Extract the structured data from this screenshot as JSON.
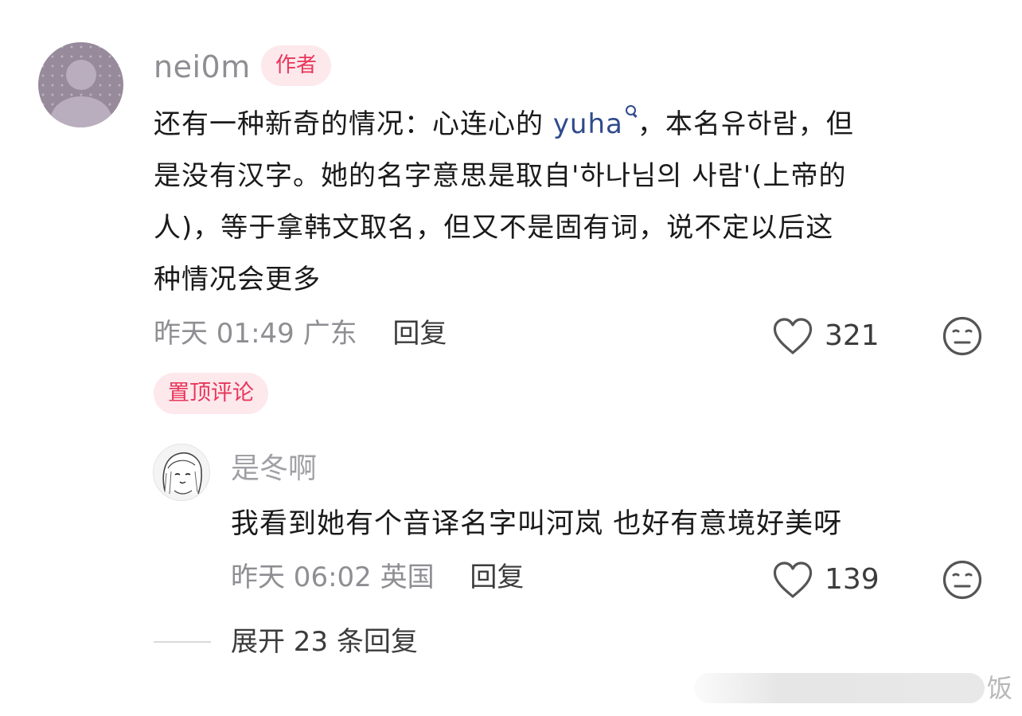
{
  "main_comment": {
    "username": "nei0m",
    "author_badge": "作者",
    "body_lines": {
      "line1_pre": "还有一种新奇的情况：心连心的 ",
      "mention": "yuha",
      "line1_post": "，本名유하람，但",
      "line2": "是没有汉字。她的名字意思是取自'하나님의 사람'(上帝的",
      "line3": "人)，等于拿韩文取名，但又不是固有词，说不定以后这",
      "line4": "种情况会更多"
    },
    "time": "昨天 01:49",
    "location": "广东",
    "reply_label": "回复",
    "like_count": "321",
    "pinned_badge": "置顶评论"
  },
  "reply_comment": {
    "username": "是冬啊",
    "body": "我看到她有个音译名字叫河岚 也好有意境好美呀",
    "time": "昨天 06:02",
    "location": "英国",
    "reply_label": "回复",
    "like_count": "139"
  },
  "expand": {
    "label": "展开 23 条回复"
  },
  "watermark": {
    "text": "饭"
  },
  "colors": {
    "accent_pink": "#e8365a",
    "badge_bg": "#fde8ec",
    "mention_blue": "#2f4a8c",
    "meta_gray": "#8e8e93"
  },
  "icons": {
    "like": "heart-outline-icon",
    "dislike": "neutral-face-icon",
    "mention": "search-icon"
  }
}
